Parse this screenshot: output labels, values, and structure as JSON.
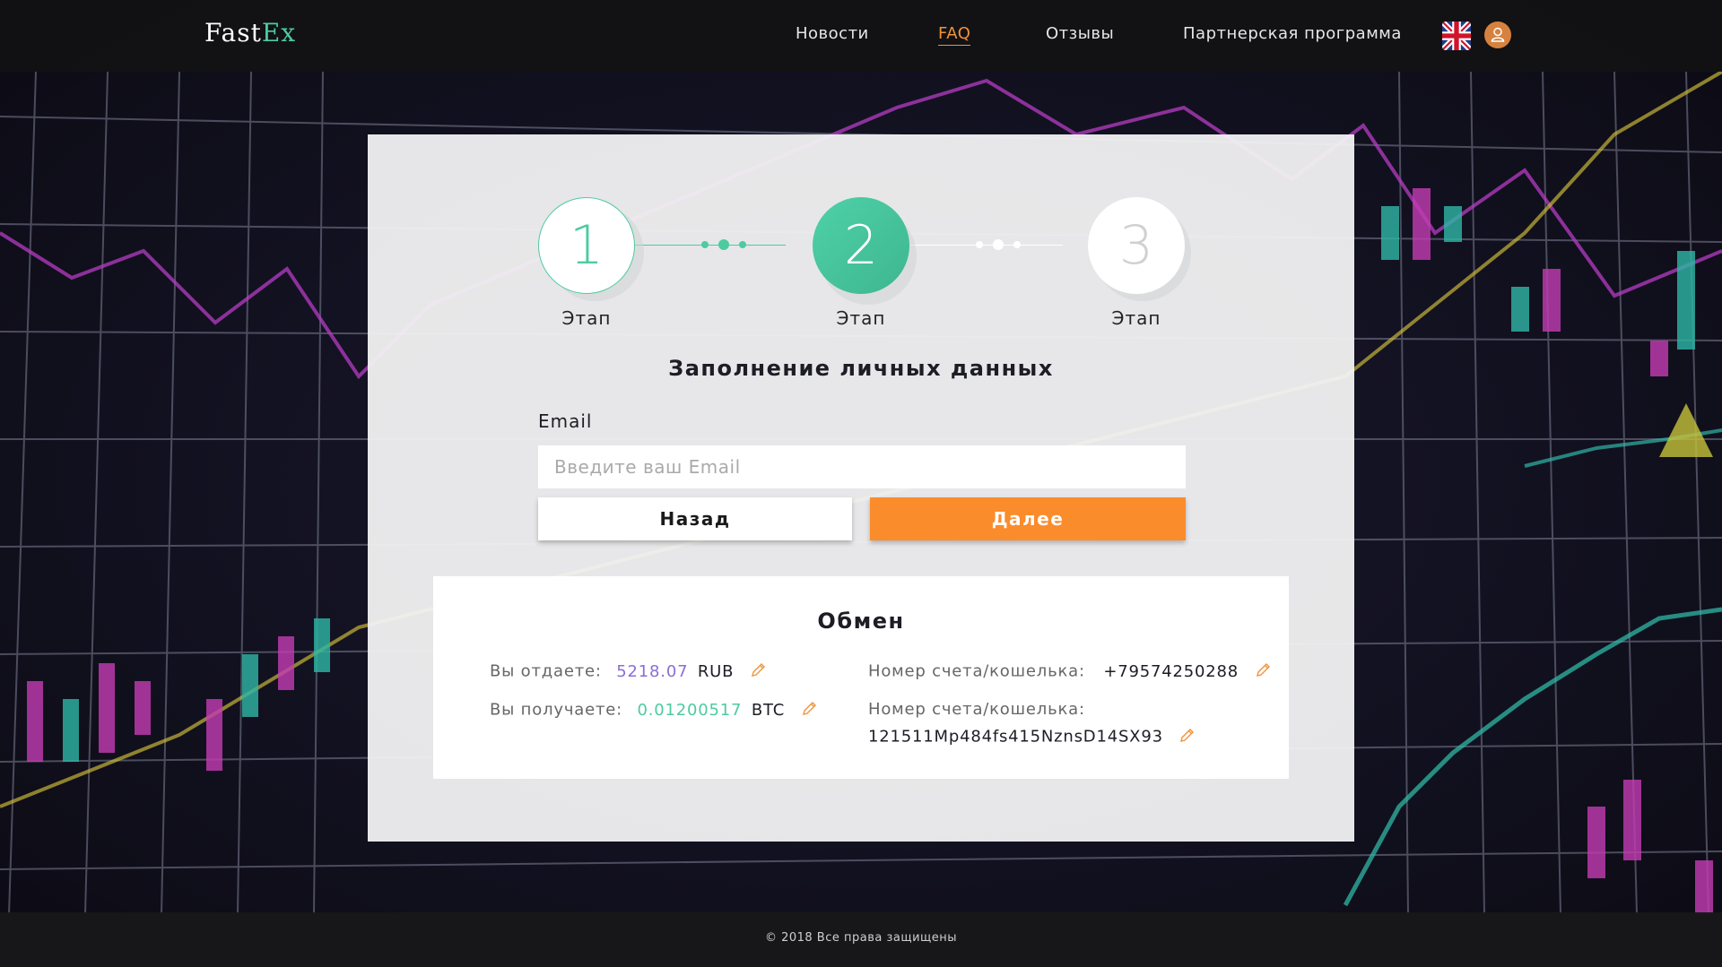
{
  "header": {
    "logo_part1": "Fast",
    "logo_part2": "Ex",
    "nav": [
      "Новости",
      "FAQ",
      "Отзывы",
      "Партнерская программа"
    ],
    "active_nav": "FAQ"
  },
  "steps": [
    {
      "number": "1",
      "label": "Этап",
      "state": "done"
    },
    {
      "number": "2",
      "label": "Этап",
      "state": "active"
    },
    {
      "number": "3",
      "label": "Этап",
      "state": "pending"
    }
  ],
  "form": {
    "title": "Заполнение личных данных",
    "email_label": "Email",
    "email_placeholder": "Введите ваш Email",
    "email_value": "",
    "back_label": "Назад",
    "next_label": "Далее"
  },
  "exchange": {
    "title": "Обмен",
    "give_label": "Вы отдаете:",
    "give_amount": "5218.07",
    "give_currency": "RUB",
    "get_label": "Вы получаете:",
    "get_amount": "0.01200517",
    "get_currency": "BTC",
    "account1_label": "Номер счета/кошелька:",
    "account1_value": "+79574250288",
    "account2_label": "Номер счета/кошелька:",
    "account2_value": "121511Mp484fs415NznsD14SX93"
  },
  "footer": {
    "copyright": "© 2018 Все права защищены"
  },
  "colors": {
    "accent_green": "#4dcb9f",
    "accent_orange": "#fb8c2c",
    "give_amount": "#8a6fd3"
  }
}
